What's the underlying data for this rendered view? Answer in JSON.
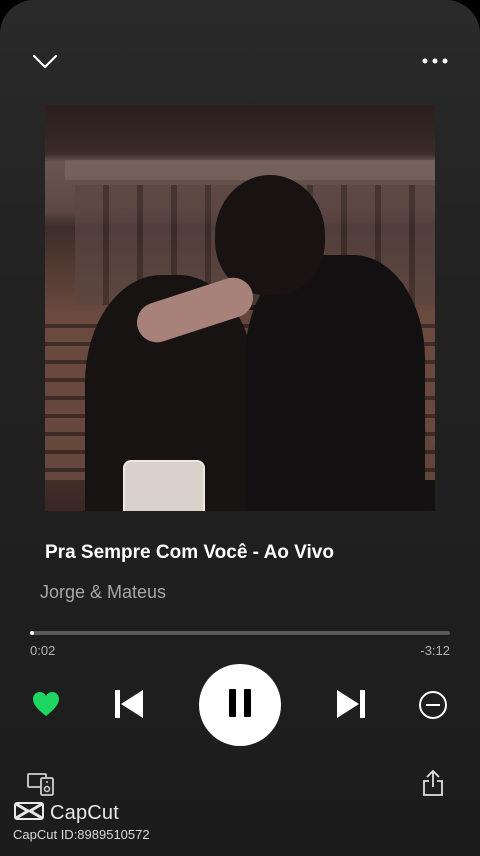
{
  "player": {
    "track_title": "Pra Sempre Com Você - Ao Vivo",
    "artist": "Jorge & Mateus",
    "elapsed": "0:02",
    "remaining": "-3:12",
    "progress_fraction": 0.01,
    "liked": true,
    "state": "playing"
  },
  "icons": {
    "collapse": "chevron-down-icon",
    "menu": "more-icon",
    "like": "heart-icon",
    "previous": "skip-previous-icon",
    "pause": "pause-icon",
    "next": "skip-next-icon",
    "remove": "minus-circle-icon",
    "devices": "devices-icon",
    "share": "share-icon"
  },
  "colors": {
    "accent": "#1ed760",
    "background": "#232323",
    "secondary_text": "#a7a7a7"
  },
  "watermark": {
    "brand": "CapCut",
    "id_text": "CapCut ID:8989510572"
  }
}
